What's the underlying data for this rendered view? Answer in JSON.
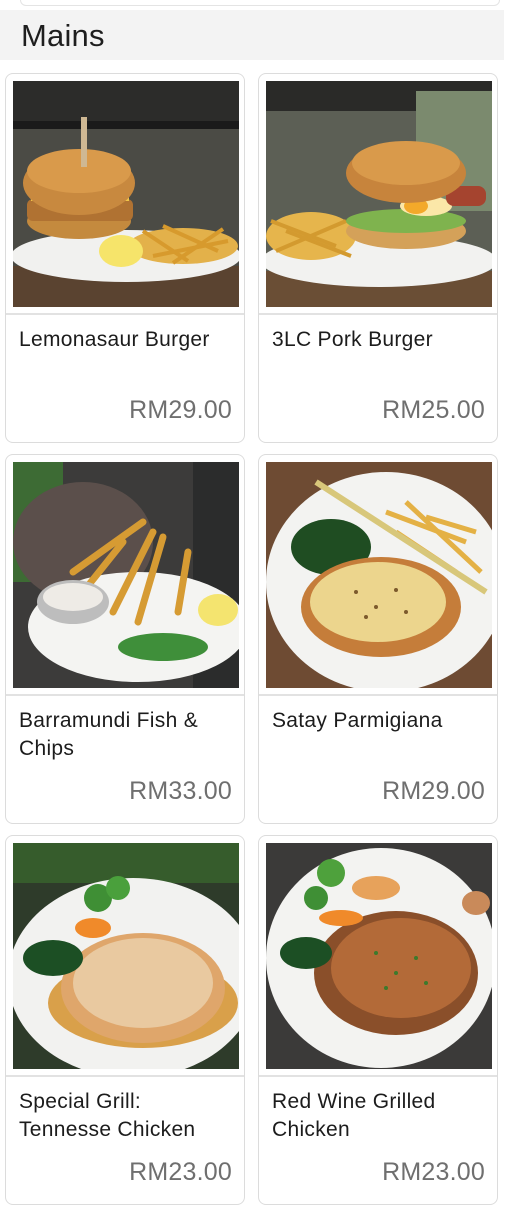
{
  "section": {
    "title": "Mains"
  },
  "items": [
    {
      "name": "Lemonasaur Burger",
      "price": "RM29.00"
    },
    {
      "name": "3LC Pork Burger",
      "price": "RM25.00"
    },
    {
      "name": "Barramundi Fish & Chips",
      "price": "RM33.00"
    },
    {
      "name": "Satay Parmigiana",
      "price": "RM29.00"
    },
    {
      "name": "Special Grill: Tennesse Chicken",
      "price": "RM23.00"
    },
    {
      "name": "Red Wine Grilled Chicken",
      "price": "RM23.00"
    }
  ]
}
